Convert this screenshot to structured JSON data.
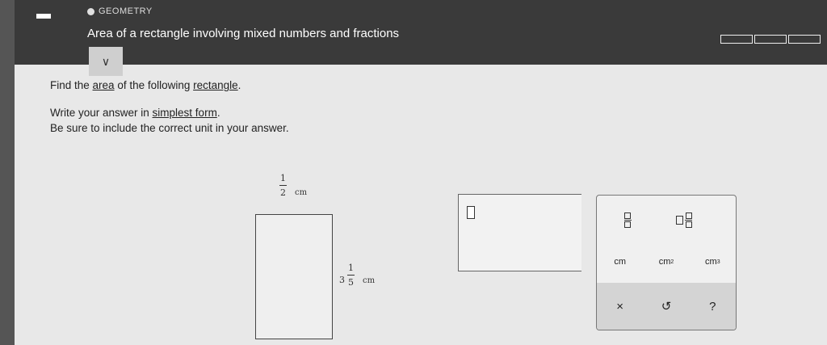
{
  "header": {
    "subject": "GEOMETRY",
    "title": "Area of a rectangle involving mixed numbers and fractions"
  },
  "question": {
    "line1_pre": "Find the ",
    "line1_area": "area",
    "line1_mid": " of the following ",
    "line1_rect": "rectangle",
    "line1_end": ".",
    "line2_pre": "Write your answer in ",
    "line2_link": "simplest form",
    "line2_end": ".",
    "line3": "Be sure to include the correct unit in your answer."
  },
  "figure": {
    "width_num": "1",
    "width_den": "2",
    "width_unit": "cm",
    "height_whole": "3",
    "height_num": "1",
    "height_den": "5",
    "height_unit": "cm"
  },
  "palette": {
    "unit_cm": "cm",
    "unit_cm2": "cm",
    "unit_cm2_sup": "2",
    "unit_cm3": "cm",
    "unit_cm3_sup": "3",
    "clear": "×",
    "undo": "↺",
    "help": "?"
  }
}
